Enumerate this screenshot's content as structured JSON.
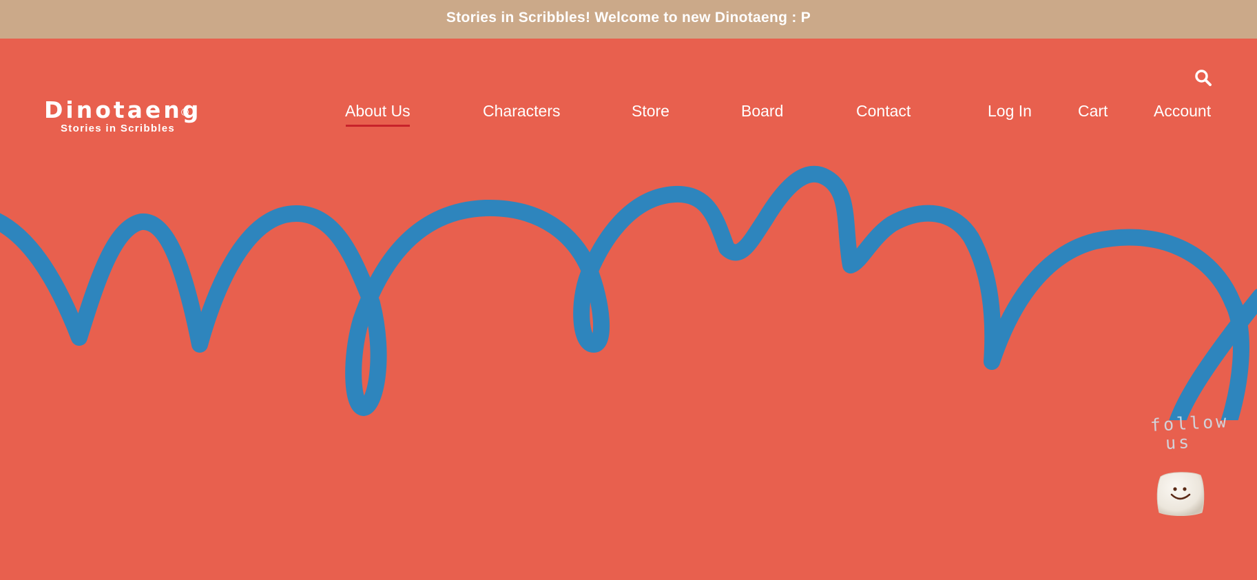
{
  "announcement": {
    "text": "Stories in Scribbles! Welcome to new Dinotaeng : P"
  },
  "brand": {
    "name": "Dinotaeng",
    "registered": "®",
    "tagline": "Stories in Scribbles"
  },
  "nav": {
    "about": "About Us",
    "characters": "Characters",
    "store": "Store",
    "board": "Board",
    "contact": "Contact",
    "login": "Log In",
    "cart": "Cart",
    "account": "Account"
  },
  "active_nav": "About Us",
  "follow": {
    "line1": "follow",
    "line2": "us"
  },
  "icons": {
    "search": "search-icon",
    "follow_button": "marshmallow-smile-icon"
  },
  "colors": {
    "background": "#e8604e",
    "announcement_bar": "#cba989",
    "scribble": "#2e85bd",
    "active_underline": "#c8222a",
    "text": "#ffffff"
  }
}
